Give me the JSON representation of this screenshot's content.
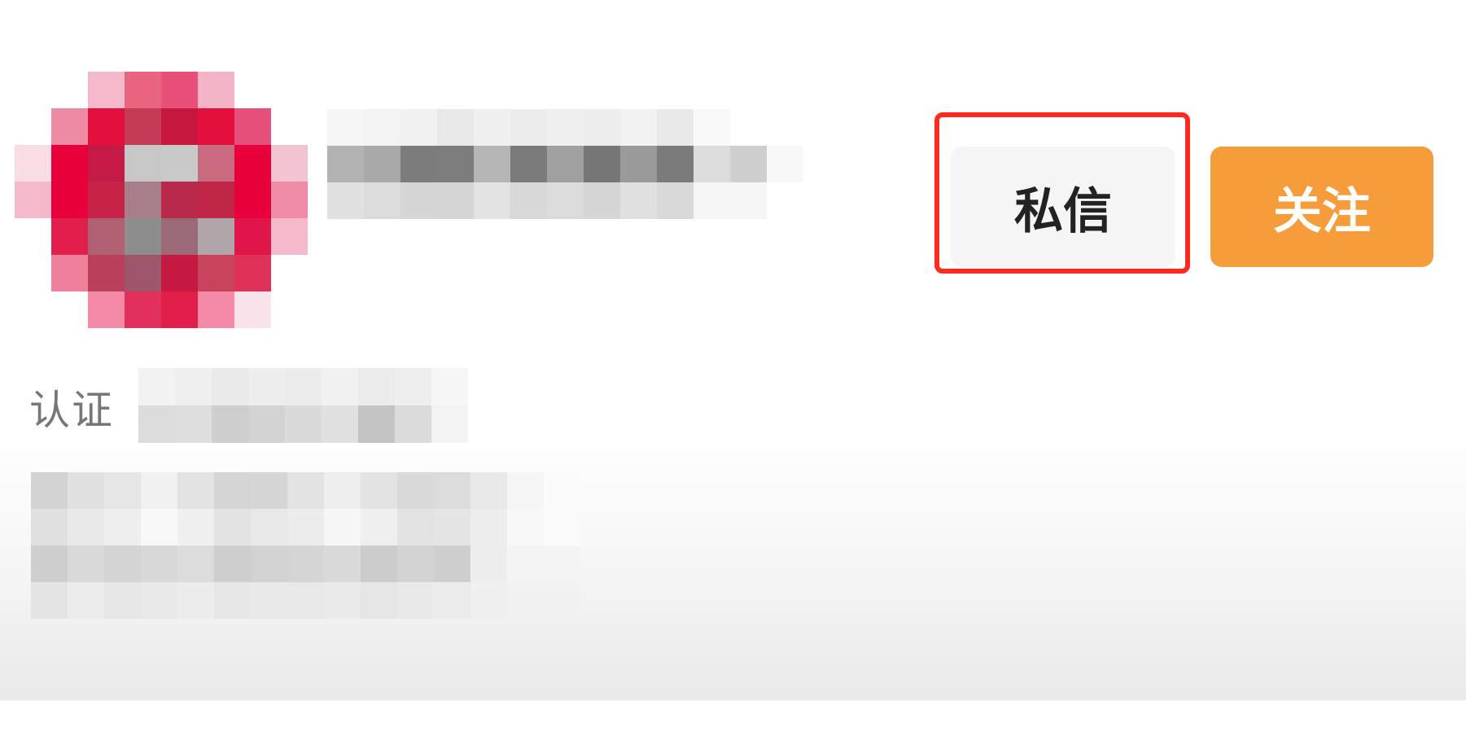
{
  "profile": {
    "certification_label": "认证",
    "avatar_colors": [
      "#e8003a",
      "#e61f4b",
      "#c21a44",
      "#f48aa8",
      "#f4b9ca",
      "#9a6670",
      "#8d8d8d",
      "#c9c9c9"
    ]
  },
  "actions": {
    "message_label": "私信",
    "follow_label": "关注"
  },
  "colors": {
    "follow_bg": "#f79c3b",
    "message_bg": "#f5f5f5",
    "highlight_border": "#ff2a1f"
  }
}
